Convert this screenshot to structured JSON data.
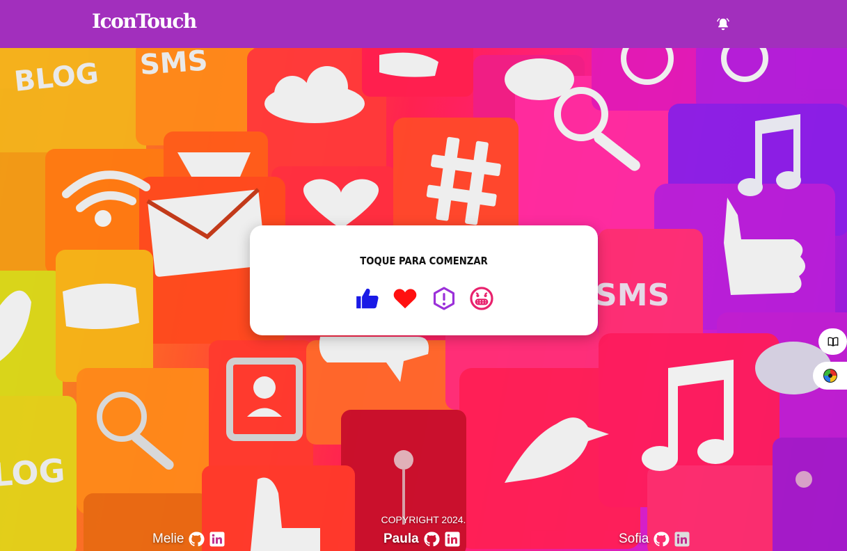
{
  "header": {
    "brand": "IconTouch",
    "notification_icon": "bell-icon"
  },
  "card": {
    "title": "TOQUE PARA COMENZAR",
    "reactions": [
      {
        "name": "thumbs-up-icon",
        "color": "#1a1ae6"
      },
      {
        "name": "heart-icon",
        "color": "#ff1010"
      },
      {
        "name": "alert-hexagon-icon",
        "color": "#9b30d9"
      },
      {
        "name": "grimace-face-icon",
        "color": "#e8216c"
      }
    ]
  },
  "side_buttons": [
    {
      "name": "book-icon"
    },
    {
      "name": "color-palette-icon"
    }
  ],
  "footer": {
    "copyright": "COPYRIGHT 2024.",
    "credits": [
      {
        "name": "Melie",
        "icons": [
          "github-icon",
          "linkedin-icon"
        ]
      },
      {
        "name": "Paula",
        "icons": [
          "github-icon",
          "linkedin-icon"
        ]
      },
      {
        "name": "Sofia",
        "icons": [
          "github-icon",
          "linkedin-icon"
        ]
      }
    ]
  },
  "colors": {
    "header_bg": "#a22fbd",
    "card_bg": "#ffffff"
  }
}
